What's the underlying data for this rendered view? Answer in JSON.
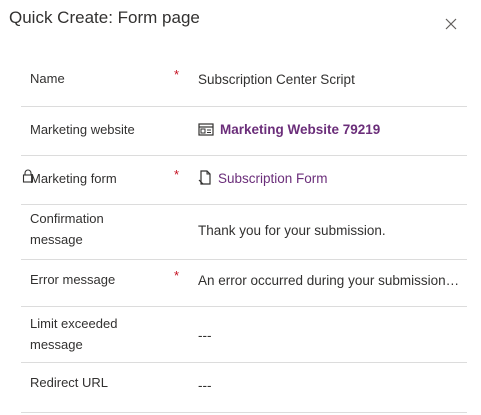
{
  "dialog": {
    "title": "Quick Create: Form page",
    "close_icon": "close-icon"
  },
  "fields": {
    "name": {
      "label": "Name",
      "required_marker": "*",
      "value": "Subscription Center Script"
    },
    "marketing_website": {
      "label": "Marketing website",
      "value": "Marketing Website 79219",
      "icon": "website-entity-icon"
    },
    "marketing_form": {
      "label": "Marketing form",
      "required_marker": "*",
      "value": "Subscription Form",
      "icon": "form-entity-icon",
      "lock_icon": "lock-icon"
    },
    "confirmation_message": {
      "label_line1": "Confirmation",
      "label_line2": "message",
      "value": "Thank you for your submission."
    },
    "error_message": {
      "label": "Error message",
      "required_marker": "*",
      "value": "An error occurred during your submission. Please try again."
    },
    "limit_exceeded_message": {
      "label_line1": "Limit exceeded",
      "label_line2": "message",
      "value": "---"
    },
    "redirect_url": {
      "label": "Redirect URL",
      "value": "---"
    }
  },
  "colors": {
    "link": "#6b2e7a",
    "required": "#c50f1f",
    "divider": "#dcdcdc",
    "text": "#323130"
  }
}
